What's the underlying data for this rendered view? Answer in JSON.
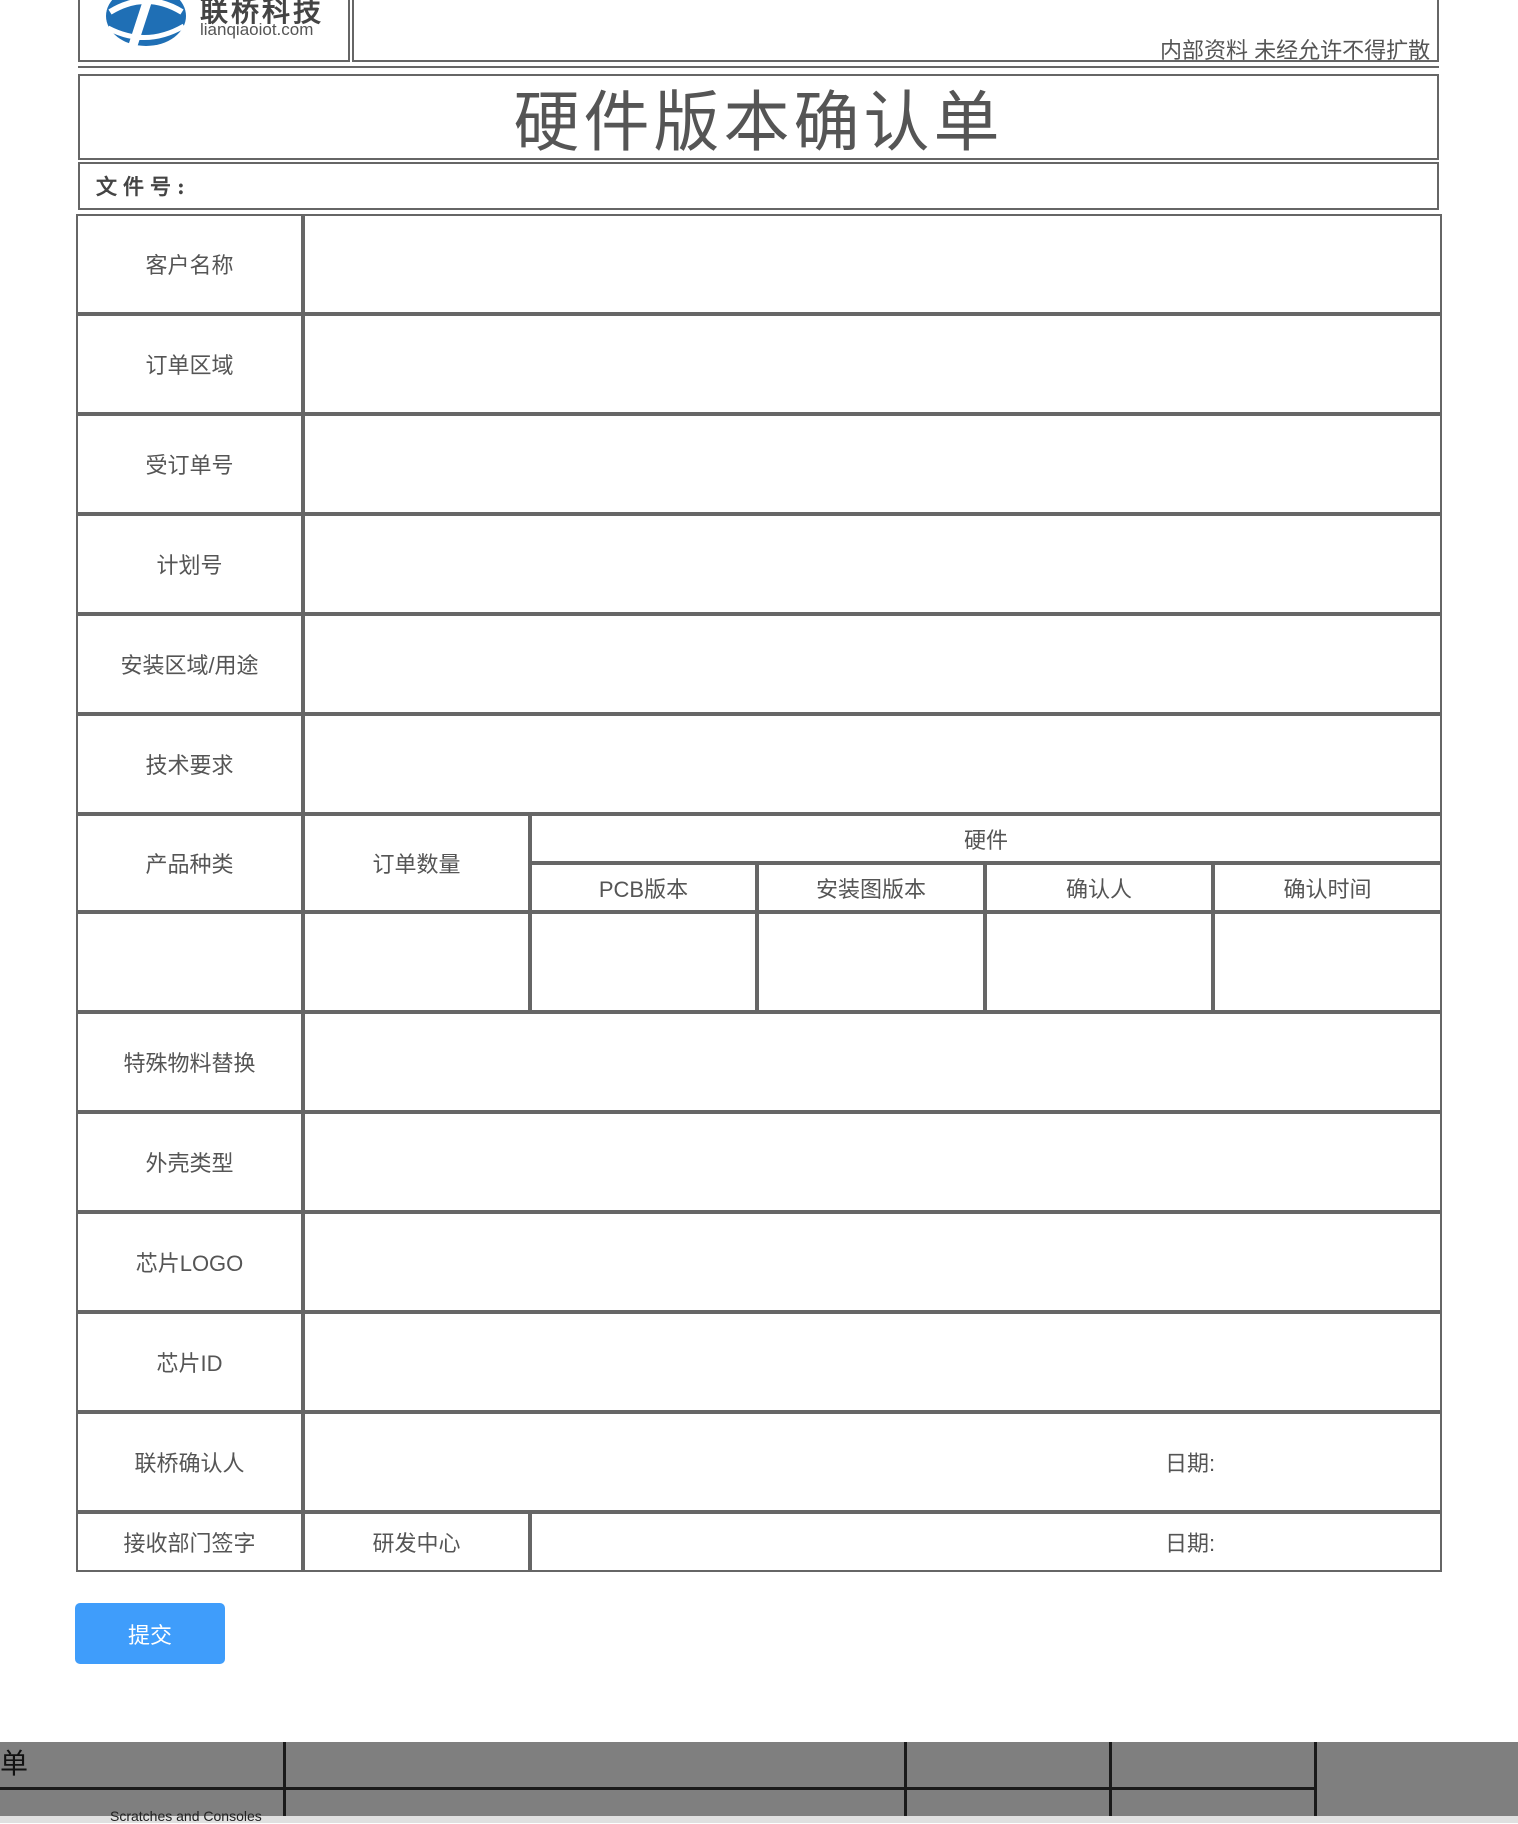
{
  "header": {
    "brand_name": "联桥科技",
    "brand_url": "lianqiaoiot.com",
    "notice": "内部资料 未经允许不得扩散",
    "title": "硬件版本确认单",
    "doc_no_label": "文件号:"
  },
  "form": {
    "rows": {
      "customer_name": "客户名称",
      "order_region": "订单区域",
      "po_number": "受订单号",
      "plan_number": "计划号",
      "install_usage": "安装区域/用途",
      "tech_requirements": "技术要求",
      "special_material": "特殊物料替换",
      "housing_type": "外壳类型",
      "chip_logo": "芯片LOGO",
      "chip_id": "芯片ID",
      "lq_confirmer": "联桥确认人",
      "receiving_signature": "接收部门签字"
    },
    "product": {
      "product_type": "产品种类",
      "order_qty": "订单数量",
      "hardware": "硬件",
      "pcb_version": "PCB版本",
      "assembly_drawing_version": "安装图版本",
      "confirmer": "确认人",
      "confirm_time": "确认时间"
    },
    "rd_center": "研发中心",
    "date_label_1": "日期:",
    "date_label_2": "日期:"
  },
  "submit_label": "提交",
  "background_strip": {
    "char": "单",
    "tab_text": "Scratches and Consoles"
  }
}
